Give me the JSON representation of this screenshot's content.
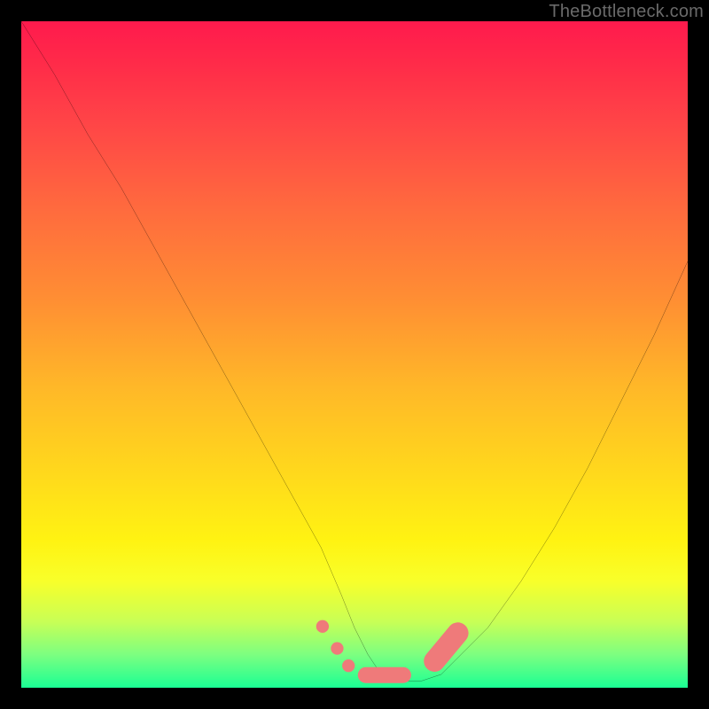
{
  "watermark": "TheBottleneck.com",
  "chart_data": {
    "type": "line",
    "title": "",
    "xlabel": "",
    "ylabel": "",
    "xlim": [
      0,
      100
    ],
    "ylim": [
      0,
      100
    ],
    "grid": false,
    "legend": false,
    "background_gradient": {
      "top": "#ff1a4d",
      "bottom": "#1aff94",
      "meaning": "top = severe bottleneck, bottom = ideal"
    },
    "series": [
      {
        "name": "bottleneck-curve",
        "color": "#000000",
        "x": [
          0,
          5,
          10,
          15,
          20,
          25,
          30,
          35,
          40,
          45,
          48,
          50,
          52,
          54,
          56,
          58,
          60,
          63,
          66,
          70,
          75,
          80,
          85,
          90,
          95,
          100
        ],
        "y": [
          100,
          92,
          83,
          75,
          66,
          57,
          48,
          39,
          30,
          21,
          14,
          9,
          5,
          2,
          1,
          1,
          1,
          2,
          5,
          9,
          16,
          24,
          33,
          43,
          53,
          64
        ]
      }
    ],
    "markers": [
      {
        "name": "left-dots",
        "shape": "circle",
        "color": "#ef7a7a",
        "points": [
          {
            "x": 45.2,
            "y": 9.2
          },
          {
            "x": 47.4,
            "y": 5.9
          },
          {
            "x": 49.1,
            "y": 3.3
          }
        ]
      },
      {
        "name": "valley-bar",
        "shape": "rounded-rect",
        "color": "#ef7a7a",
        "x0": 50.5,
        "x1": 58.5,
        "y": 0.7,
        "h": 2.4
      },
      {
        "name": "right-cap",
        "shape": "capsule",
        "color": "#ef7a7a",
        "p0": {
          "x": 62.0,
          "y": 4.0
        },
        "p1": {
          "x": 65.5,
          "y": 8.2
        },
        "r": 1.6
      }
    ]
  }
}
